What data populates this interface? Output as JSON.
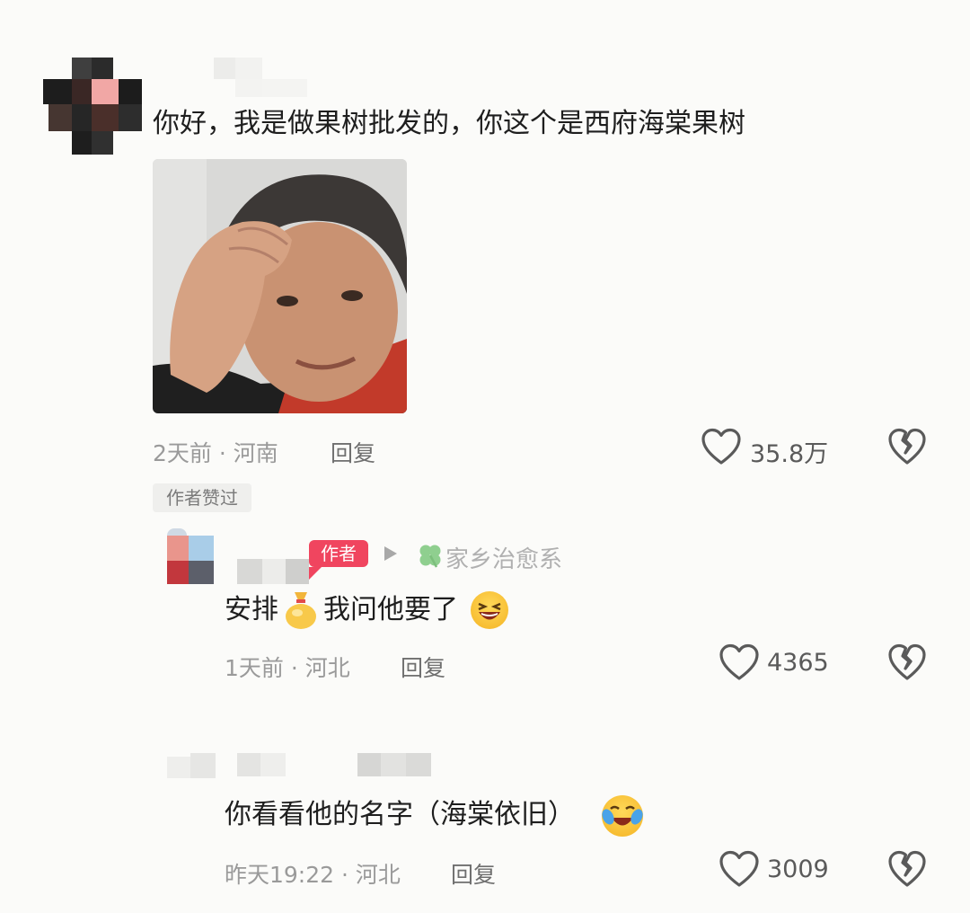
{
  "comments": [
    {
      "text": "你好，我是做果树批发的，你这个是西府海棠果树",
      "time_location": "2天前 · 河南",
      "reply_label": "回复",
      "like_count": "35.8万",
      "author_liked_label": "作者赞过",
      "image": "meme-photo"
    },
    {
      "author_tag": "作者",
      "reply_to": "家乡治愈系",
      "text_a": "安排",
      "text_b": "我问他要了",
      "time_location": "1天前 · 河北",
      "reply_label": "回复",
      "like_count": "4365"
    },
    {
      "text": "你看看他的名字（海棠依旧）",
      "time_location": "昨天19:22 · 河北",
      "reply_label": "回复",
      "like_count": "3009"
    }
  ],
  "icons": {
    "like": "heart-outline-icon",
    "dislike": "broken-heart-icon",
    "reply_arrow": "triangle-right-icon",
    "clover": "clover-icon",
    "emoji_bag": "money-bag-emoji",
    "emoji_laugh": "laughing-emoji",
    "emoji_tears": "tears-of-joy-emoji"
  },
  "colors": {
    "author_tag": "#f0455f",
    "clover": "#8fcf8f",
    "meta_text": "#9a9a9a"
  }
}
